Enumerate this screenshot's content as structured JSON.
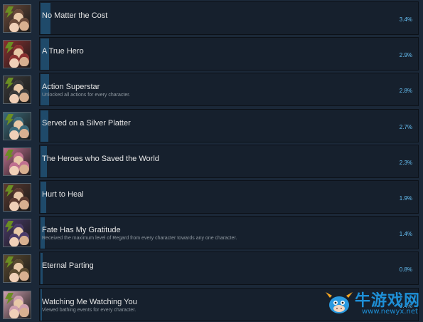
{
  "achievements": [
    {
      "title": "No Matter the Cost",
      "description": "",
      "percent": "3.4%",
      "ratio": 0.034,
      "icon": "character-portrait-icon",
      "tone": "#6a4a3a"
    },
    {
      "title": "A True Hero",
      "description": "",
      "percent": "2.9%",
      "ratio": 0.029,
      "icon": "character-portrait-icon",
      "tone": "#8a3030"
    },
    {
      "title": "Action Superstar",
      "description": "Unlocked all actions for every character.",
      "percent": "2.8%",
      "ratio": 0.028,
      "icon": "character-portrait-icon",
      "tone": "#3a3a3a"
    },
    {
      "title": "Served on a Silver Platter",
      "description": "",
      "percent": "2.7%",
      "ratio": 0.027,
      "icon": "character-portrait-icon",
      "tone": "#3a6a7a"
    },
    {
      "title": "The Heroes who Saved the World",
      "description": "",
      "percent": "2.3%",
      "ratio": 0.023,
      "icon": "character-portrait-icon",
      "tone": "#c07090"
    },
    {
      "title": "Hurt to Heal",
      "description": "",
      "percent": "1.9%",
      "ratio": 0.019,
      "icon": "character-portrait-icon",
      "tone": "#5a3a30"
    },
    {
      "title": "Fate Has My Gratitude",
      "description": "Received the maximum level of Regard from every character towards any one character.",
      "percent": "1.4%",
      "ratio": 0.014,
      "icon": "character-portrait-icon",
      "tone": "#4a3a6a"
    },
    {
      "title": "Eternal Parting",
      "description": "",
      "percent": "0.8%",
      "ratio": 0.008,
      "icon": "character-portrait-icon",
      "tone": "#5a4a30"
    },
    {
      "title": "Watching Me Watching You",
      "description": "Viewed bathing events for every character.",
      "percent": "0.4%",
      "ratio": 0.004,
      "icon": "character-portrait-icon",
      "tone": "#d0a0b0"
    }
  ],
  "watermark": {
    "title": "牛游戏网",
    "url": "www.newyx.net",
    "icon": "cow-mascot-icon"
  },
  "colors": {
    "background": "#1b2838",
    "bar": "#1f4a6a",
    "percent": "#67c1f5"
  }
}
